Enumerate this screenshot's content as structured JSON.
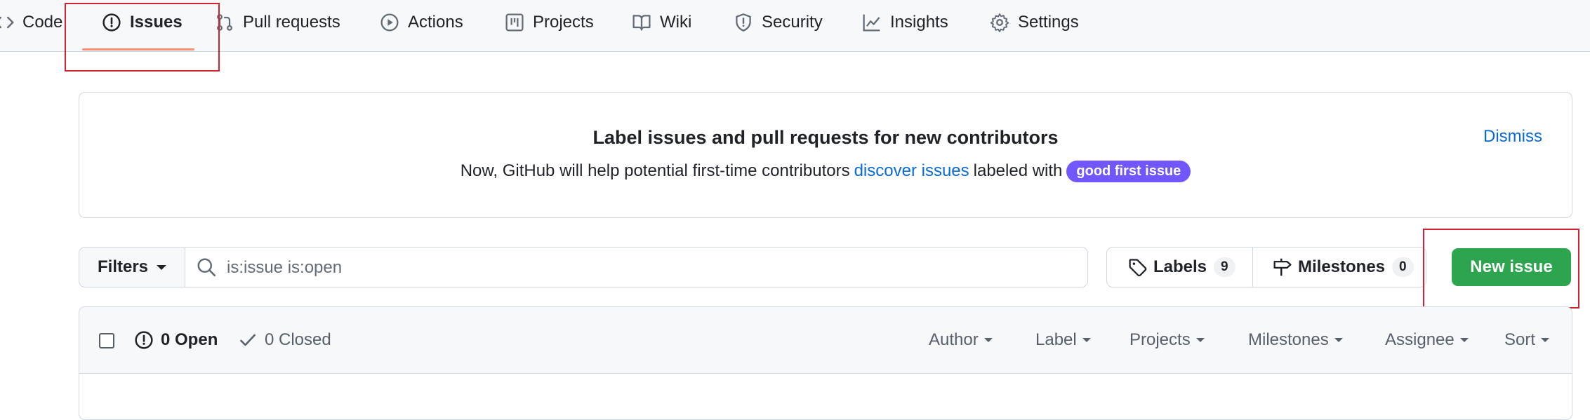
{
  "repo_nav": {
    "tabs": [
      {
        "label": "Code",
        "icon": "code-icon"
      },
      {
        "label": "Issues",
        "icon": "issue-opened-icon",
        "selected": true
      },
      {
        "label": "Pull requests",
        "icon": "git-pull-request-icon"
      },
      {
        "label": "Actions",
        "icon": "play-icon"
      },
      {
        "label": "Projects",
        "icon": "table-icon"
      },
      {
        "label": "Wiki",
        "icon": "book-icon"
      },
      {
        "label": "Security",
        "icon": "shield-icon"
      },
      {
        "label": "Insights",
        "icon": "graph-icon"
      },
      {
        "label": "Settings",
        "icon": "gear-icon"
      }
    ]
  },
  "banner": {
    "title": "Label issues and pull requests for new contributors",
    "text_before": "Now, GitHub will help potential first-time contributors",
    "link": "discover issues",
    "text_after": "labeled with",
    "label_pill": "good first issue",
    "dismiss": "Dismiss"
  },
  "filter_bar": {
    "filters_label": "Filters",
    "search_value": "is:issue is:open"
  },
  "labels_button": {
    "label": "Labels",
    "count": "9"
  },
  "milestones_button": {
    "label": "Milestones",
    "count": "0"
  },
  "new_issue_button": "New issue",
  "issues_header": {
    "open": "0 Open",
    "closed": "0 Closed",
    "columns": [
      "Author",
      "Label",
      "Projects",
      "Milestones",
      "Assignee",
      "Sort"
    ]
  },
  "colors": {
    "accent_link": "#0969da",
    "primary_button": "#2da44e",
    "good_first_issue": "#7057ff",
    "highlight_box": "#d1242f",
    "tab_underline": "#fd8c73"
  }
}
